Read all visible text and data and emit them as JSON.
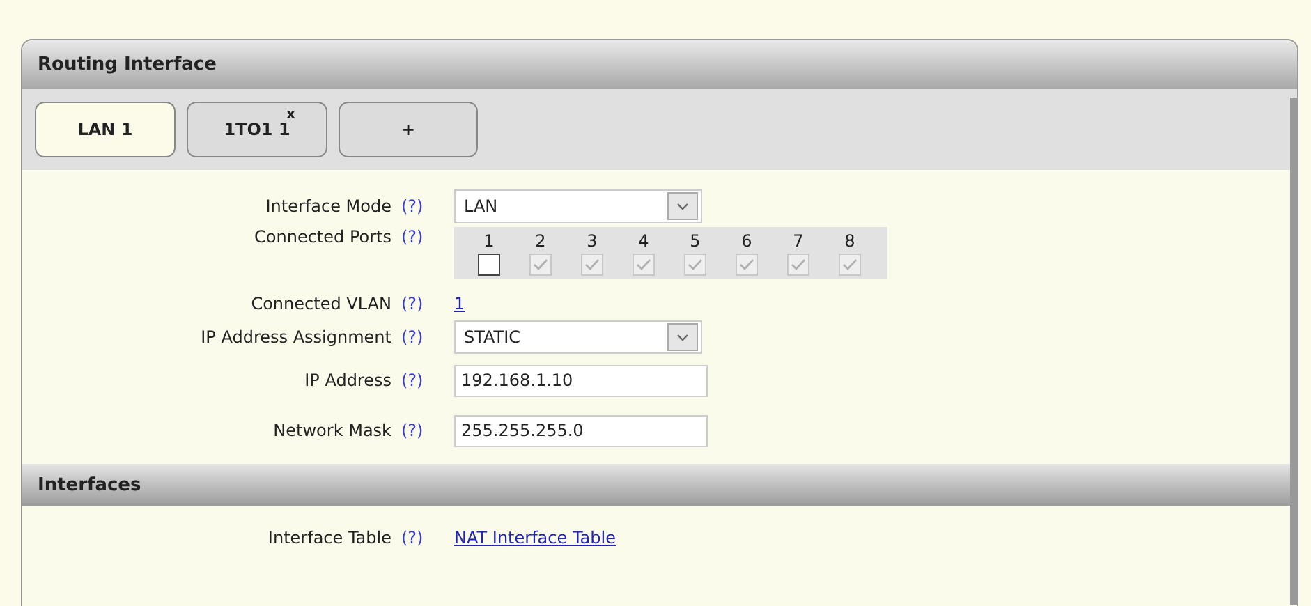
{
  "panel": {
    "title": "Routing Interface"
  },
  "tabs": [
    {
      "label": "LAN 1",
      "selected": true
    },
    {
      "label": "1TO1 1",
      "selected": false,
      "close": "x"
    },
    {
      "label": "+",
      "selected": false
    }
  ],
  "fields": [
    {
      "kind": "select",
      "label": "Interface Mode",
      "help": "(?)",
      "value": "LAN"
    },
    {
      "kind": "ports",
      "label": "Connected Ports",
      "help": "(?)",
      "ports": [
        {
          "label": "1",
          "checked": false,
          "disabled": false
        },
        {
          "label": "2",
          "checked": true,
          "disabled": true
        },
        {
          "label": "3",
          "checked": true,
          "disabled": true
        },
        {
          "label": "4",
          "checked": true,
          "disabled": true
        },
        {
          "label": "5",
          "checked": true,
          "disabled": true
        },
        {
          "label": "6",
          "checked": true,
          "disabled": true
        },
        {
          "label": "7",
          "checked": true,
          "disabled": true
        },
        {
          "label": "8",
          "checked": true,
          "disabled": true
        }
      ]
    },
    {
      "kind": "link",
      "label": "Connected VLAN",
      "help": "(?)",
      "value": "1"
    },
    {
      "kind": "select",
      "label": "IP Address Assignment",
      "help": "(?)",
      "value": "STATIC"
    },
    {
      "kind": "input",
      "label": "IP Address",
      "help": "(?)",
      "value": "192.168.1.10"
    },
    {
      "kind": "input",
      "label": "Network Mask",
      "help": "(?)",
      "value": "255.255.255.0"
    }
  ],
  "interfaces": {
    "title": "Interfaces",
    "fields": [
      {
        "kind": "link",
        "label": "Interface Table",
        "help": "(?)",
        "value": "NAT Interface Table"
      }
    ]
  }
}
